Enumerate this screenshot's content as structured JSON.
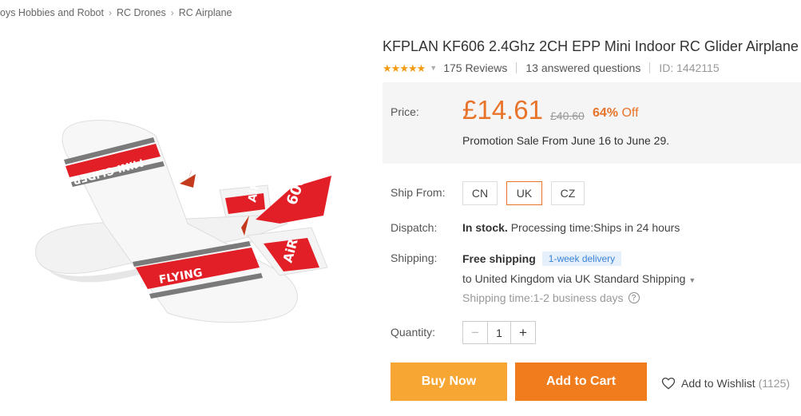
{
  "breadcrumb": {
    "items": [
      "oys Hobbies and Robot",
      "RC Drones",
      "RC Airplane"
    ],
    "separator": "›"
  },
  "product": {
    "title": "KFPLAN KF606 2.4Ghz 2CH EPP Mini Indoor RC Glider Airplane",
    "rating_stars": 5,
    "reviews": "175 Reviews",
    "questions": "13 answered questions",
    "id_text": "ID: 1442115"
  },
  "price": {
    "label": "Price:",
    "current": "£14.61",
    "original": "£40.60",
    "discount": "64%",
    "discount_suffix": "Off",
    "promotion": "Promotion Sale From June 16 to June 29."
  },
  "ship_from": {
    "label": "Ship From:",
    "options": [
      "CN",
      "UK",
      "CZ"
    ],
    "selected": "UK"
  },
  "dispatch": {
    "label": "Dispatch:",
    "stock": "In stock.",
    "processing": "Processing time:Ships in 24 hours"
  },
  "shipping": {
    "label": "Shipping:",
    "free": "Free shipping",
    "badge": "1-week delivery",
    "destination": "to United Kingdom via UK Standard Shipping",
    "time_label": "Shipping time:",
    "time_value": "1-2 business days"
  },
  "quantity": {
    "label": "Quantity:",
    "value": "1",
    "minus": "−",
    "plus": "+"
  },
  "actions": {
    "buy_now": "Buy Now",
    "add_to_cart": "Add to Cart",
    "wishlist": "Add to Wishlist",
    "wishlist_count": "(1125)"
  },
  "image_text": {
    "wing_top": "MINI GLIDER",
    "wing_bottom": "FLYING",
    "tail_fin": "606",
    "stab_left": "AiR",
    "stab_right": "AiR"
  },
  "colors": {
    "accent": "#e8742a",
    "buy_now": "#f7a533",
    "add_to_cart": "#f07c1d",
    "star": "#f39c12",
    "badge_bg": "#e6f0fb",
    "badge_text": "#3a83d6"
  }
}
